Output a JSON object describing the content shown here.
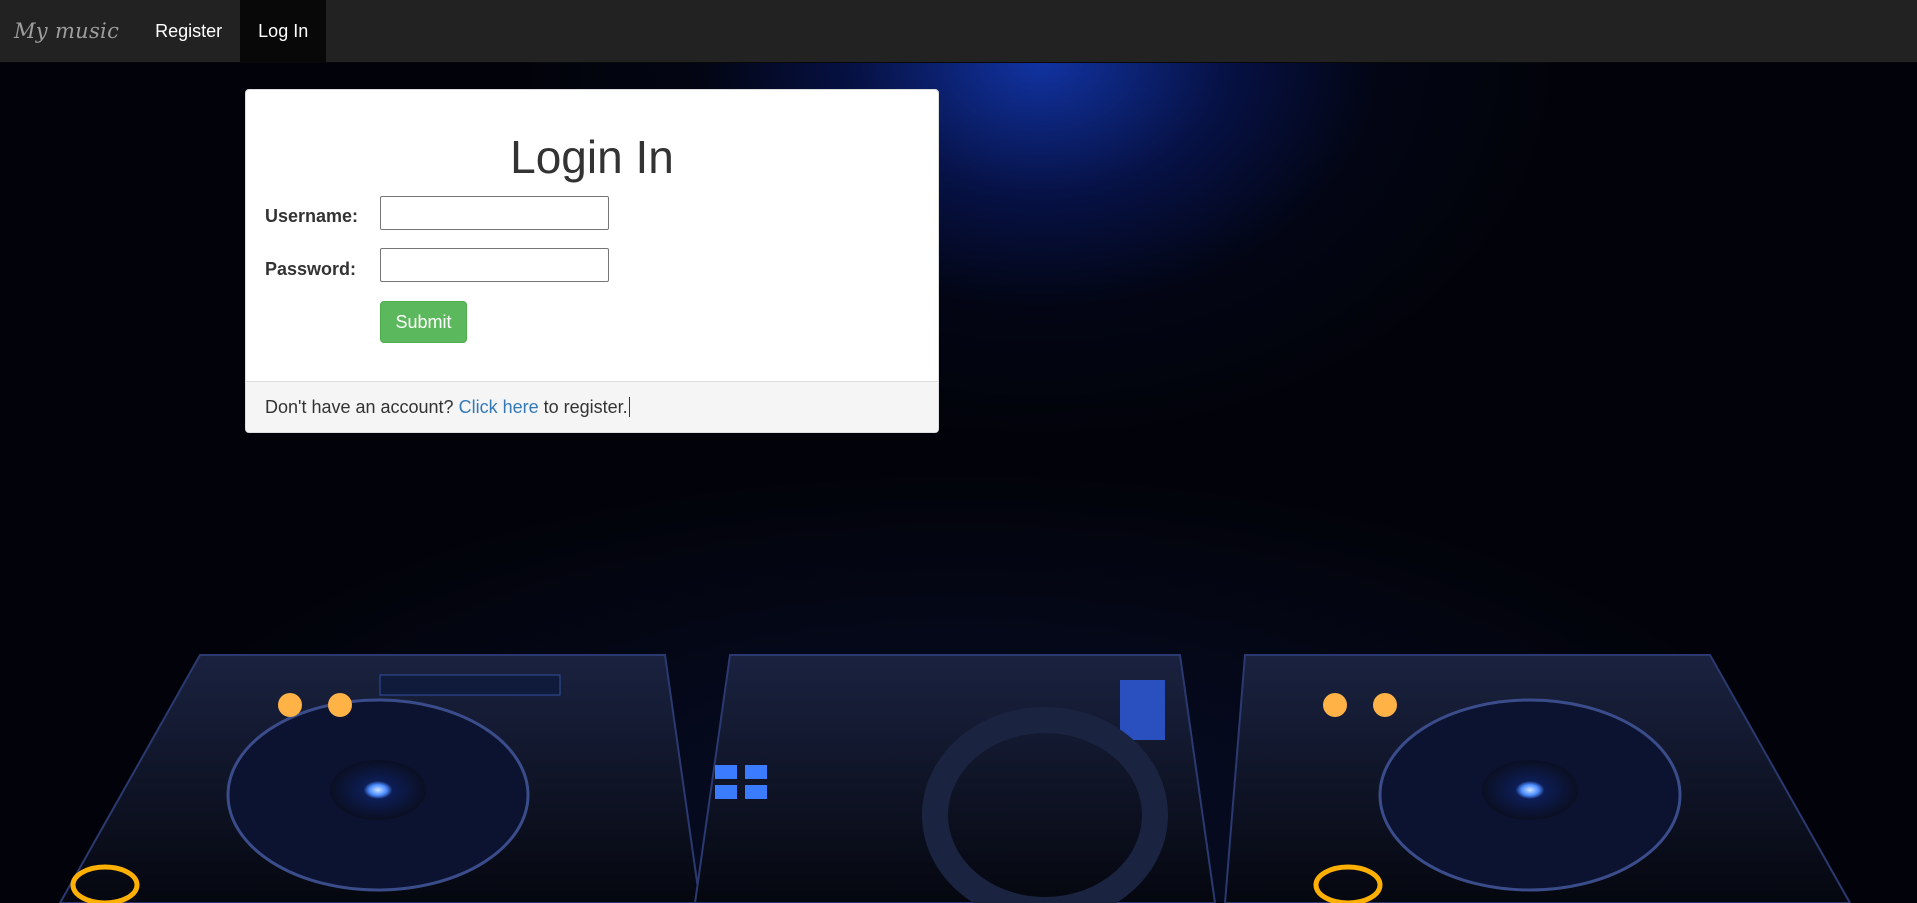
{
  "navbar": {
    "brand": "My music",
    "items": [
      {
        "label": "Register",
        "active": false
      },
      {
        "label": "Log In",
        "active": true
      }
    ]
  },
  "login_panel": {
    "title": "Login In",
    "username_label": "Username:",
    "username_value": "",
    "password_label": "Password:",
    "password_value": "",
    "submit_label": "Submit"
  },
  "footer": {
    "prefix": "Don't have an account?",
    "link_text": "Click here",
    "suffix": "to register."
  },
  "colors": {
    "navbar_bg": "#222222",
    "active_nav_bg": "#080808",
    "submit_green": "#5cb85c",
    "link_blue": "#337ab7"
  }
}
